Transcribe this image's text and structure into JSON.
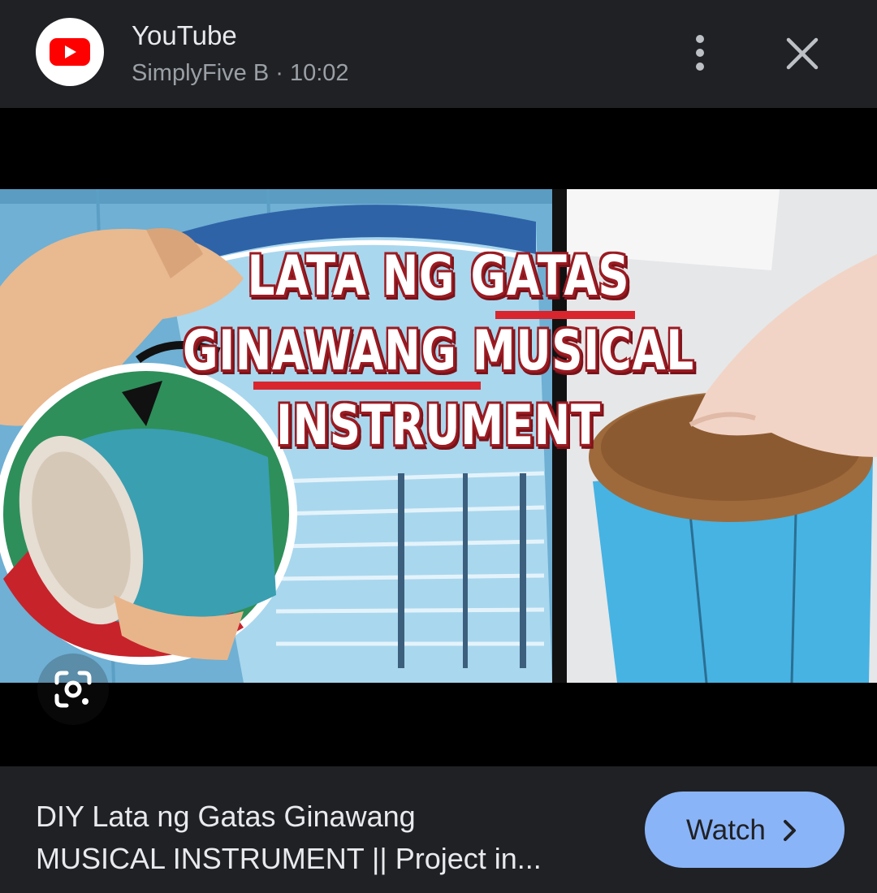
{
  "header": {
    "source_title": "YouTube",
    "source_subtitle": "SimplyFive B · 10:02",
    "logo_icon": "youtube-logo-icon",
    "more_icon": "more-vertical-icon",
    "close_icon": "close-icon"
  },
  "image": {
    "headline_line1": "LATA NG GATAS",
    "headline_line2": "GINAWANG MUSICAL",
    "headline_line3": "INSTRUMENT",
    "lens_icon": "google-lens-icon"
  },
  "footer": {
    "title_line1": "DIY Lata ng Gatas Ginawang",
    "title_line2": "MUSICAL INSTRUMENT || Project in...",
    "watch_label": "Watch",
    "watch_icon": "chevron-right-icon"
  },
  "colors": {
    "background": "#202124",
    "watch_button": "#8ab4f8",
    "youtube_red": "#ff0000",
    "headline_red": "#d9262e"
  }
}
